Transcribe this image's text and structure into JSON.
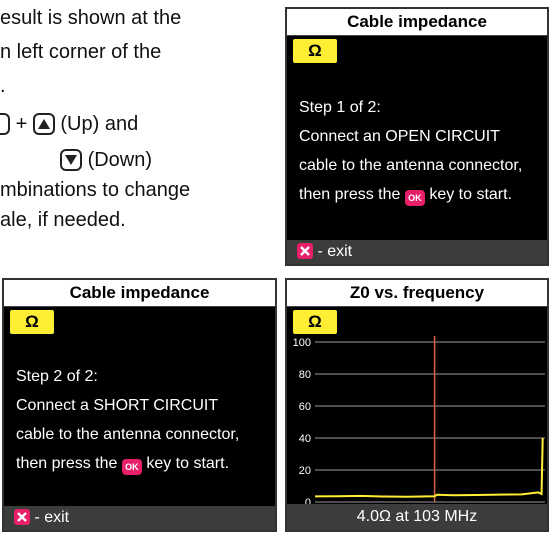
{
  "manual": {
    "line1": "esult is shown at the",
    "line2": "n left corner of the",
    "line3": ".",
    "plus": "+",
    "up_label": "(Up) and",
    "down_label": "(Down)",
    "line6": "mbinations to change",
    "line7": "ale, if needed."
  },
  "screen1": {
    "title": "Cable impedance",
    "badge": "Ω",
    "step": "Step 1 of 2:",
    "line1": "Connect an OPEN CIRCUIT",
    "line2": "cable to the antenna connector,",
    "line3_pre": "then press the",
    "line3_post": "key to start.",
    "ok_key": "OK",
    "exit": "- exit"
  },
  "screen2": {
    "title": "Cable impedance",
    "badge": "Ω",
    "step": "Step 2 of 2:",
    "line1": "Connect a SHORT CIRCUIT",
    "line2": "cable to the antenna connector,",
    "line3_pre": "then press the",
    "line3_post": "key to start.",
    "ok_key": "OK",
    "exit": "- exit"
  },
  "screen3": {
    "title": "Z0 vs. frequency",
    "badge": "Ω",
    "readout": "4.0Ω at 103 MHz"
  },
  "colors": {
    "badge": "#ffee33",
    "key": "#e8206a",
    "trace": "#ffee33",
    "cursor": "#e06050",
    "footer": "#3a3d3a"
  },
  "chart_data": {
    "type": "line",
    "title": "Z0 vs. frequency",
    "ylim": [
      0,
      100
    ],
    "yticks": [
      0,
      20,
      40,
      60,
      80,
      100
    ],
    "grid": true,
    "cursor_x_fraction": 0.52,
    "series": [
      {
        "x_fraction": [
          0.0,
          0.1,
          0.2,
          0.3,
          0.4,
          0.52,
          0.53,
          0.6,
          0.7,
          0.8,
          0.9,
          0.97,
          0.985,
          0.99
        ],
        "values": [
          3.5,
          3.6,
          3.8,
          3.4,
          3.3,
          3.6,
          4.5,
          4.2,
          4.4,
          4.6,
          4.8,
          6.0,
          5.0,
          40.0
        ]
      }
    ]
  }
}
